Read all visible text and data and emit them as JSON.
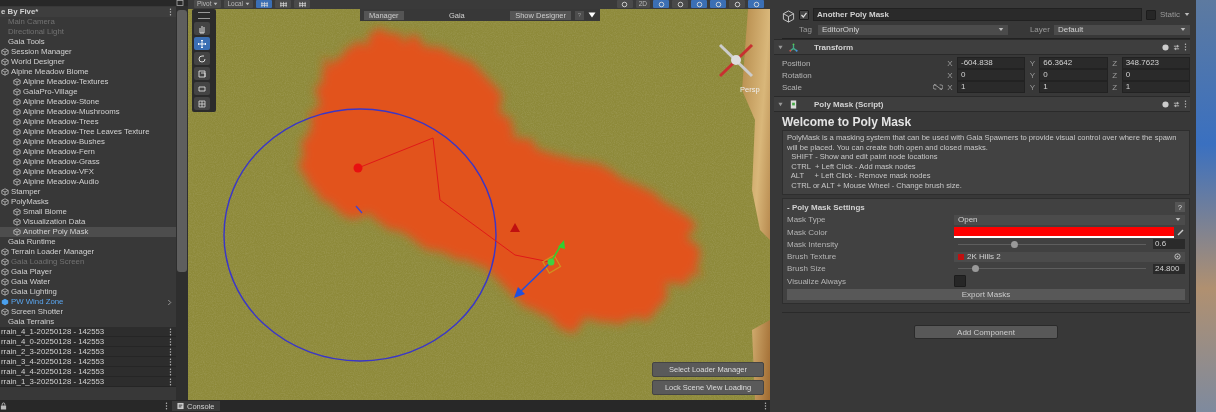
{
  "hierarchy": {
    "scene_title": "e By Five*",
    "items": [
      {
        "label": "Main Camera",
        "kind": "object",
        "disabled": true,
        "selected": false
      },
      {
        "label": "Directional Light",
        "kind": "object",
        "disabled": true,
        "selected": false
      },
      {
        "label": "Gaia Tools",
        "kind": "object",
        "disabled": false,
        "selected": false,
        "children": [
          {
            "label": "Session Manager",
            "kind": "object",
            "disabled": false,
            "selected": false
          },
          {
            "label": "World Designer",
            "kind": "object",
            "disabled": false,
            "selected": false
          },
          {
            "label": "Alpine Meadow Biome",
            "kind": "object",
            "disabled": false,
            "selected": false,
            "children": [
              {
                "label": "Alpine Meadow-Textures",
                "kind": "object",
                "disabled": false,
                "selected": false
              },
              {
                "label": "GaiaPro-Village",
                "kind": "object",
                "disabled": false,
                "selected": false
              },
              {
                "label": "Alpine Meadow-Stone",
                "kind": "object",
                "disabled": false,
                "selected": false
              },
              {
                "label": "Alpine Meadow-Mushrooms",
                "kind": "object",
                "disabled": false,
                "selected": false
              },
              {
                "label": "Alpine Meadow-Trees",
                "kind": "object",
                "disabled": false,
                "selected": false
              },
              {
                "label": "Alpine Meadow-Tree Leaves Texture",
                "kind": "object",
                "disabled": false,
                "selected": false
              },
              {
                "label": "Alpine Meadow-Bushes",
                "kind": "object",
                "disabled": false,
                "selected": false
              },
              {
                "label": "Alpine Meadow-Fern",
                "kind": "object",
                "disabled": false,
                "selected": false
              },
              {
                "label": "Alpine Meadow-Grass",
                "kind": "object",
                "disabled": false,
                "selected": false
              },
              {
                "label": "Alpine Meadow-VFX",
                "kind": "object",
                "disabled": false,
                "selected": false
              },
              {
                "label": "Alpine Meadow-Audio",
                "kind": "object",
                "disabled": false,
                "selected": false
              }
            ]
          },
          {
            "label": "Stamper",
            "kind": "object",
            "disabled": false,
            "selected": false
          },
          {
            "label": "PolyMasks",
            "kind": "object",
            "disabled": false,
            "selected": false,
            "children": [
              {
                "label": "Small Biome",
                "kind": "object",
                "disabled": false,
                "selected": false
              },
              {
                "label": "Visualization Data",
                "kind": "object",
                "disabled": false,
                "selected": false
              },
              {
                "label": "Another Poly Mask",
                "kind": "object",
                "disabled": false,
                "selected": true
              }
            ]
          }
        ]
      },
      {
        "label": "Gaia Runtime",
        "kind": "object",
        "disabled": false,
        "selected": false,
        "children": [
          {
            "label": "Terrain Loader Manager",
            "kind": "object",
            "disabled": false,
            "selected": false
          },
          {
            "label": "Gaia Loading Screen",
            "kind": "object",
            "disabled": true,
            "selected": false
          },
          {
            "label": "Gaia Player",
            "kind": "object",
            "disabled": false,
            "selected": false
          },
          {
            "label": "Gaia Water",
            "kind": "object",
            "disabled": false,
            "selected": false
          },
          {
            "label": "Gaia Lighting",
            "kind": "object",
            "disabled": false,
            "selected": false
          },
          {
            "label": "PW Wind Zone",
            "kind": "prefab",
            "disabled": false,
            "selected": false
          },
          {
            "label": "Screen Shotter",
            "kind": "object",
            "disabled": false,
            "selected": false
          }
        ]
      },
      {
        "label": "Gaia Terrains",
        "kind": "object",
        "disabled": false,
        "selected": false
      },
      {
        "label": "rrain_4_1-20250128 - 142553",
        "kind": "scene",
        "disabled": false,
        "selected": false
      },
      {
        "label": "rrain_4_0-20250128 - 142553",
        "kind": "scene",
        "disabled": false,
        "selected": false
      },
      {
        "label": "rrain_2_3-20250128 - 142553",
        "kind": "scene",
        "disabled": false,
        "selected": false
      },
      {
        "label": "rrain_3_4-20250128 - 142553",
        "kind": "scene",
        "disabled": false,
        "selected": false
      },
      {
        "label": "rrain_4_4-20250128 - 142553",
        "kind": "scene",
        "disabled": false,
        "selected": false
      },
      {
        "label": "rrain_1_3-20250128 - 142553",
        "kind": "scene",
        "disabled": false,
        "selected": false
      }
    ]
  },
  "scene": {
    "toolbar": {
      "left": [
        {
          "kind": "dropdown",
          "label": "Pivot",
          "selected": false
        },
        {
          "kind": "dropdown",
          "label": "Local",
          "selected": false
        },
        {
          "kind": "icon",
          "selected": true
        },
        {
          "kind": "icon",
          "selected": false
        },
        {
          "kind": "icon",
          "selected": false
        }
      ],
      "right": [
        {
          "kind": "icon",
          "selected": false
        },
        {
          "kind": "text",
          "label": "2D",
          "selected": false
        },
        {
          "kind": "icon",
          "selected": true
        },
        {
          "kind": "icon",
          "selected": false
        },
        {
          "kind": "icon",
          "selected": true
        },
        {
          "kind": "icon",
          "selected": true
        },
        {
          "kind": "icon",
          "selected": false
        },
        {
          "kind": "icon",
          "selected": true
        }
      ]
    },
    "tools": [
      {
        "kind": "hand",
        "selected": false
      },
      {
        "kind": "move",
        "selected": true
      },
      {
        "kind": "rotate",
        "selected": false
      },
      {
        "kind": "scale",
        "selected": false
      },
      {
        "kind": "rect",
        "selected": false
      },
      {
        "kind": "transform",
        "selected": false
      }
    ],
    "overlay": {
      "manager_button": "Manager",
      "title": "Gaia",
      "designer_button": "Show Designer",
      "help_button": "?"
    },
    "camera_mode": "Persp",
    "loader_buttons": [
      "Select Loader Manager",
      "Lock Scene View Loading"
    ]
  },
  "console_tab": "Console",
  "inspector": {
    "object": {
      "active": true,
      "name": "Another Poly Mask",
      "static_label": "Static",
      "static": false,
      "tag_label": "Tag",
      "tag": "EditorOnly",
      "layer_label": "Layer",
      "layer": "Default"
    },
    "transform": {
      "title": "Transform",
      "expanded": true,
      "rows": [
        {
          "label": "Position",
          "kind": "vector",
          "fields": [
            {
              "axis": "X",
              "value": "-604.838"
            },
            {
              "axis": "Y",
              "value": "66.3642"
            },
            {
              "axis": "Z",
              "value": "348.7623"
            }
          ]
        },
        {
          "label": "Rotation",
          "kind": "vector",
          "fields": [
            {
              "axis": "X",
              "value": "0"
            },
            {
              "axis": "Y",
              "value": "0"
            },
            {
              "axis": "Z",
              "value": "0"
            }
          ]
        },
        {
          "label": "Scale",
          "kind": "scale",
          "fields": [
            {
              "axis": "X",
              "value": "1"
            },
            {
              "axis": "Y",
              "value": "1"
            },
            {
              "axis": "Z",
              "value": "1"
            }
          ]
        }
      ]
    },
    "script": {
      "title": "Poly Mask (Script)",
      "expanded": true,
      "heading": "Welcome to Poly Mask",
      "help": [
        "PolyMask is a masking system that can be used with Gaia Spawners to provide visual control over where the spawn will be placed. You can create both open and closed masks.",
        "  SHIFT - Show and edit paint node locations",
        "  CTRL  + Left Click - Add mask nodes",
        "  ALT     + Left Click - Remove mask nodes",
        "  CTRL or ALT + Mouse Wheel - Change brush size."
      ],
      "settings": {
        "title": "- Poly Mask Settings",
        "help_button": "?",
        "rows": [
          {
            "kind": "dropdown",
            "label": "Mask Type",
            "value": "Open"
          },
          {
            "kind": "color",
            "label": "Mask Color",
            "color": "#ff0000"
          },
          {
            "kind": "slider",
            "label": "Mask Intensity",
            "level": 0.3,
            "value": "0.6"
          },
          {
            "kind": "object",
            "label": "Brush Texture",
            "value": "2K Hills 2"
          },
          {
            "kind": "slider",
            "label": "Brush Size",
            "level": 0.09,
            "value": "24.800"
          },
          {
            "kind": "checkbox",
            "label": "Visualize Always",
            "checked": false
          }
        ],
        "export_button": "Export Masks"
      }
    },
    "add_component": "Add Component"
  }
}
